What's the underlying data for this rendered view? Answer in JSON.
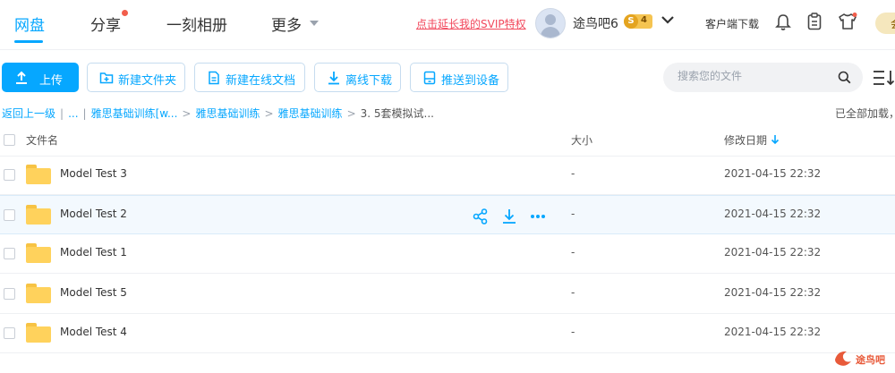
{
  "nav": {
    "tabs": [
      {
        "label": "网盘",
        "active": true
      },
      {
        "label": "分享",
        "has_dot": true
      },
      {
        "label": "一刻相册"
      },
      {
        "label": "更多",
        "has_caret": true
      }
    ],
    "promo_link": "点击延长我的SVIP特权",
    "username": "途鸟吧6",
    "vip_badge": {
      "icon": "S",
      "level": "4"
    },
    "client_download": "客户端下载",
    "member_label": "会",
    "accent_color": "#06a7ff"
  },
  "toolbar": {
    "upload": "上传",
    "new_folder": "新建文件夹",
    "new_online_doc": "新建在线文档",
    "offline_download": "离线下载",
    "push_to_device": "推送到设备",
    "search_placeholder": "搜索您的文件"
  },
  "breadcrumb": {
    "back": "返回上一级",
    "divider": "|",
    "ellipsis": "...",
    "items": [
      "雅思基础训练[w...",
      "雅思基础训练",
      "雅思基础训练"
    ],
    "current": "3. 5套模拟试...",
    "status": "已全部加载，"
  },
  "table": {
    "columns": {
      "name": "文件名",
      "size": "大小",
      "modified": "修改日期"
    },
    "sort": {
      "column": "modified",
      "direction": "desc"
    },
    "rows": [
      {
        "name": "Model Test 3",
        "size": "-",
        "modified": "2021-04-15 22:32"
      },
      {
        "name": "Model Test 2",
        "size": "-",
        "modified": "2021-04-15 22:32",
        "hovered": true
      },
      {
        "name": "Model Test 1",
        "size": "-",
        "modified": "2021-04-15 22:32"
      },
      {
        "name": "Model Test 5",
        "size": "-",
        "modified": "2021-04-15 22:32"
      },
      {
        "name": "Model Test 4",
        "size": "-",
        "modified": "2021-04-15 22:32"
      }
    ]
  },
  "watermark": {
    "text": "途鸟吧"
  }
}
